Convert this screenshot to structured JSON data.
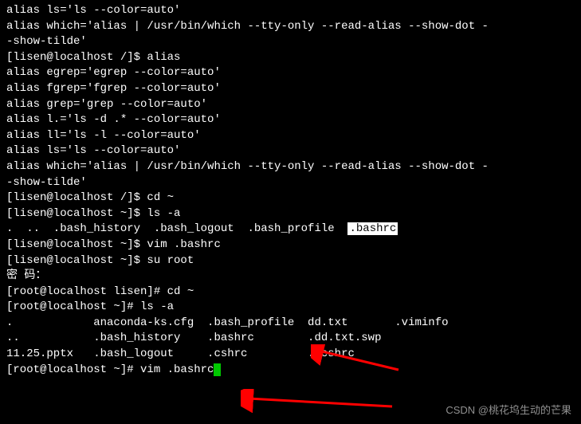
{
  "lines": [
    "alias ls='ls --color=auto'",
    "alias which='alias | /usr/bin/which --tty-only --read-alias --show-dot -",
    "-show-tilde'",
    "[lisen@localhost /]$ alias",
    "alias egrep='egrep --color=auto'",
    "alias fgrep='fgrep --color=auto'",
    "alias grep='grep --color=auto'",
    "alias l.='ls -d .* --color=auto'",
    "alias ll='ls -l --color=auto'",
    "alias ls='ls --color=auto'",
    "alias which='alias | /usr/bin/which --tty-only --read-alias --show-dot -",
    "-show-tilde'",
    "[lisen@localhost /]$ cd ~",
    "[lisen@localhost ~]$ ls -a",
    ".  ..  .bash_history  .bash_logout  .bash_profile  ",
    "[lisen@localhost ~]$ vim .bashrc",
    "[lisen@localhost ~]$ su root",
    "密 码：",
    "[root@localhost lisen]# cd ~",
    "[root@localhost ~]# ls -a",
    ".            anaconda-ks.cfg  .bash_profile  dd.txt       .viminfo",
    "..           .bash_history    .bashrc        .dd.txt.swp",
    "11.25.pptx   .bash_logout     .cshrc         .tcshrc",
    "[root@localhost ~]# vim .bashrc"
  ],
  "highlighted": ".bashrc",
  "watermark": "CSDN @桃花坞生动的芒果",
  "arrow_color": "#ff0000"
}
